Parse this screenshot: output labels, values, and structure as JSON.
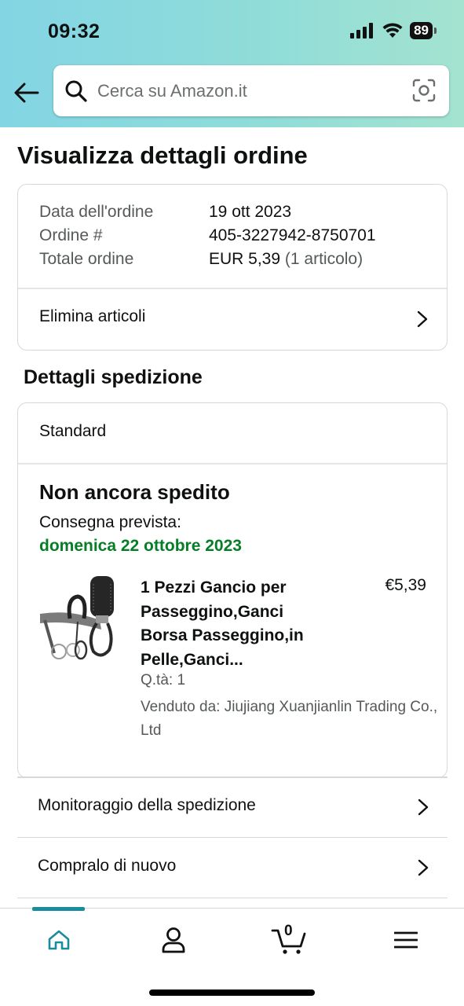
{
  "status_bar": {
    "time": "09:32",
    "battery": "89"
  },
  "search": {
    "placeholder": "Cerca su Amazon.it"
  },
  "page": {
    "title": "Visualizza dettagli ordine"
  },
  "order": {
    "date_label": "Data dell'ordine",
    "date_value": "19 ott 2023",
    "number_label": "Ordine #",
    "number_value": "405-3227942-8750701",
    "total_label": "Totale ordine",
    "total_value": "EUR 5,39",
    "total_items": "(1 articolo)",
    "delete_label": "Elimina articoli"
  },
  "shipment": {
    "section_title": "Dettagli spedizione",
    "method": "Standard",
    "status": "Non ancora spedito",
    "delivery_label": "Consegna prevista:",
    "delivery_date": "domenica 22 ottobre 2023",
    "status_color": "#067d26",
    "product": {
      "title": "1 Pezzi Gancio per Passeggino,Ganci Borsa Passeggino,in Pelle,Ganci...",
      "price": "€5,39",
      "qty": "Q.tà: 1",
      "seller": "Venduto da: Jiujiang Xuanjianlin Trading Co., Ltd"
    }
  },
  "actions": {
    "track": "Monitoraggio della spedizione",
    "buy_again": "Compralo di nuovo"
  },
  "bottom_nav": {
    "cart_count": "0",
    "active_color": "#1a8c9b",
    "items": [
      "home-icon",
      "account-icon",
      "cart-icon",
      "menu-icon"
    ]
  }
}
